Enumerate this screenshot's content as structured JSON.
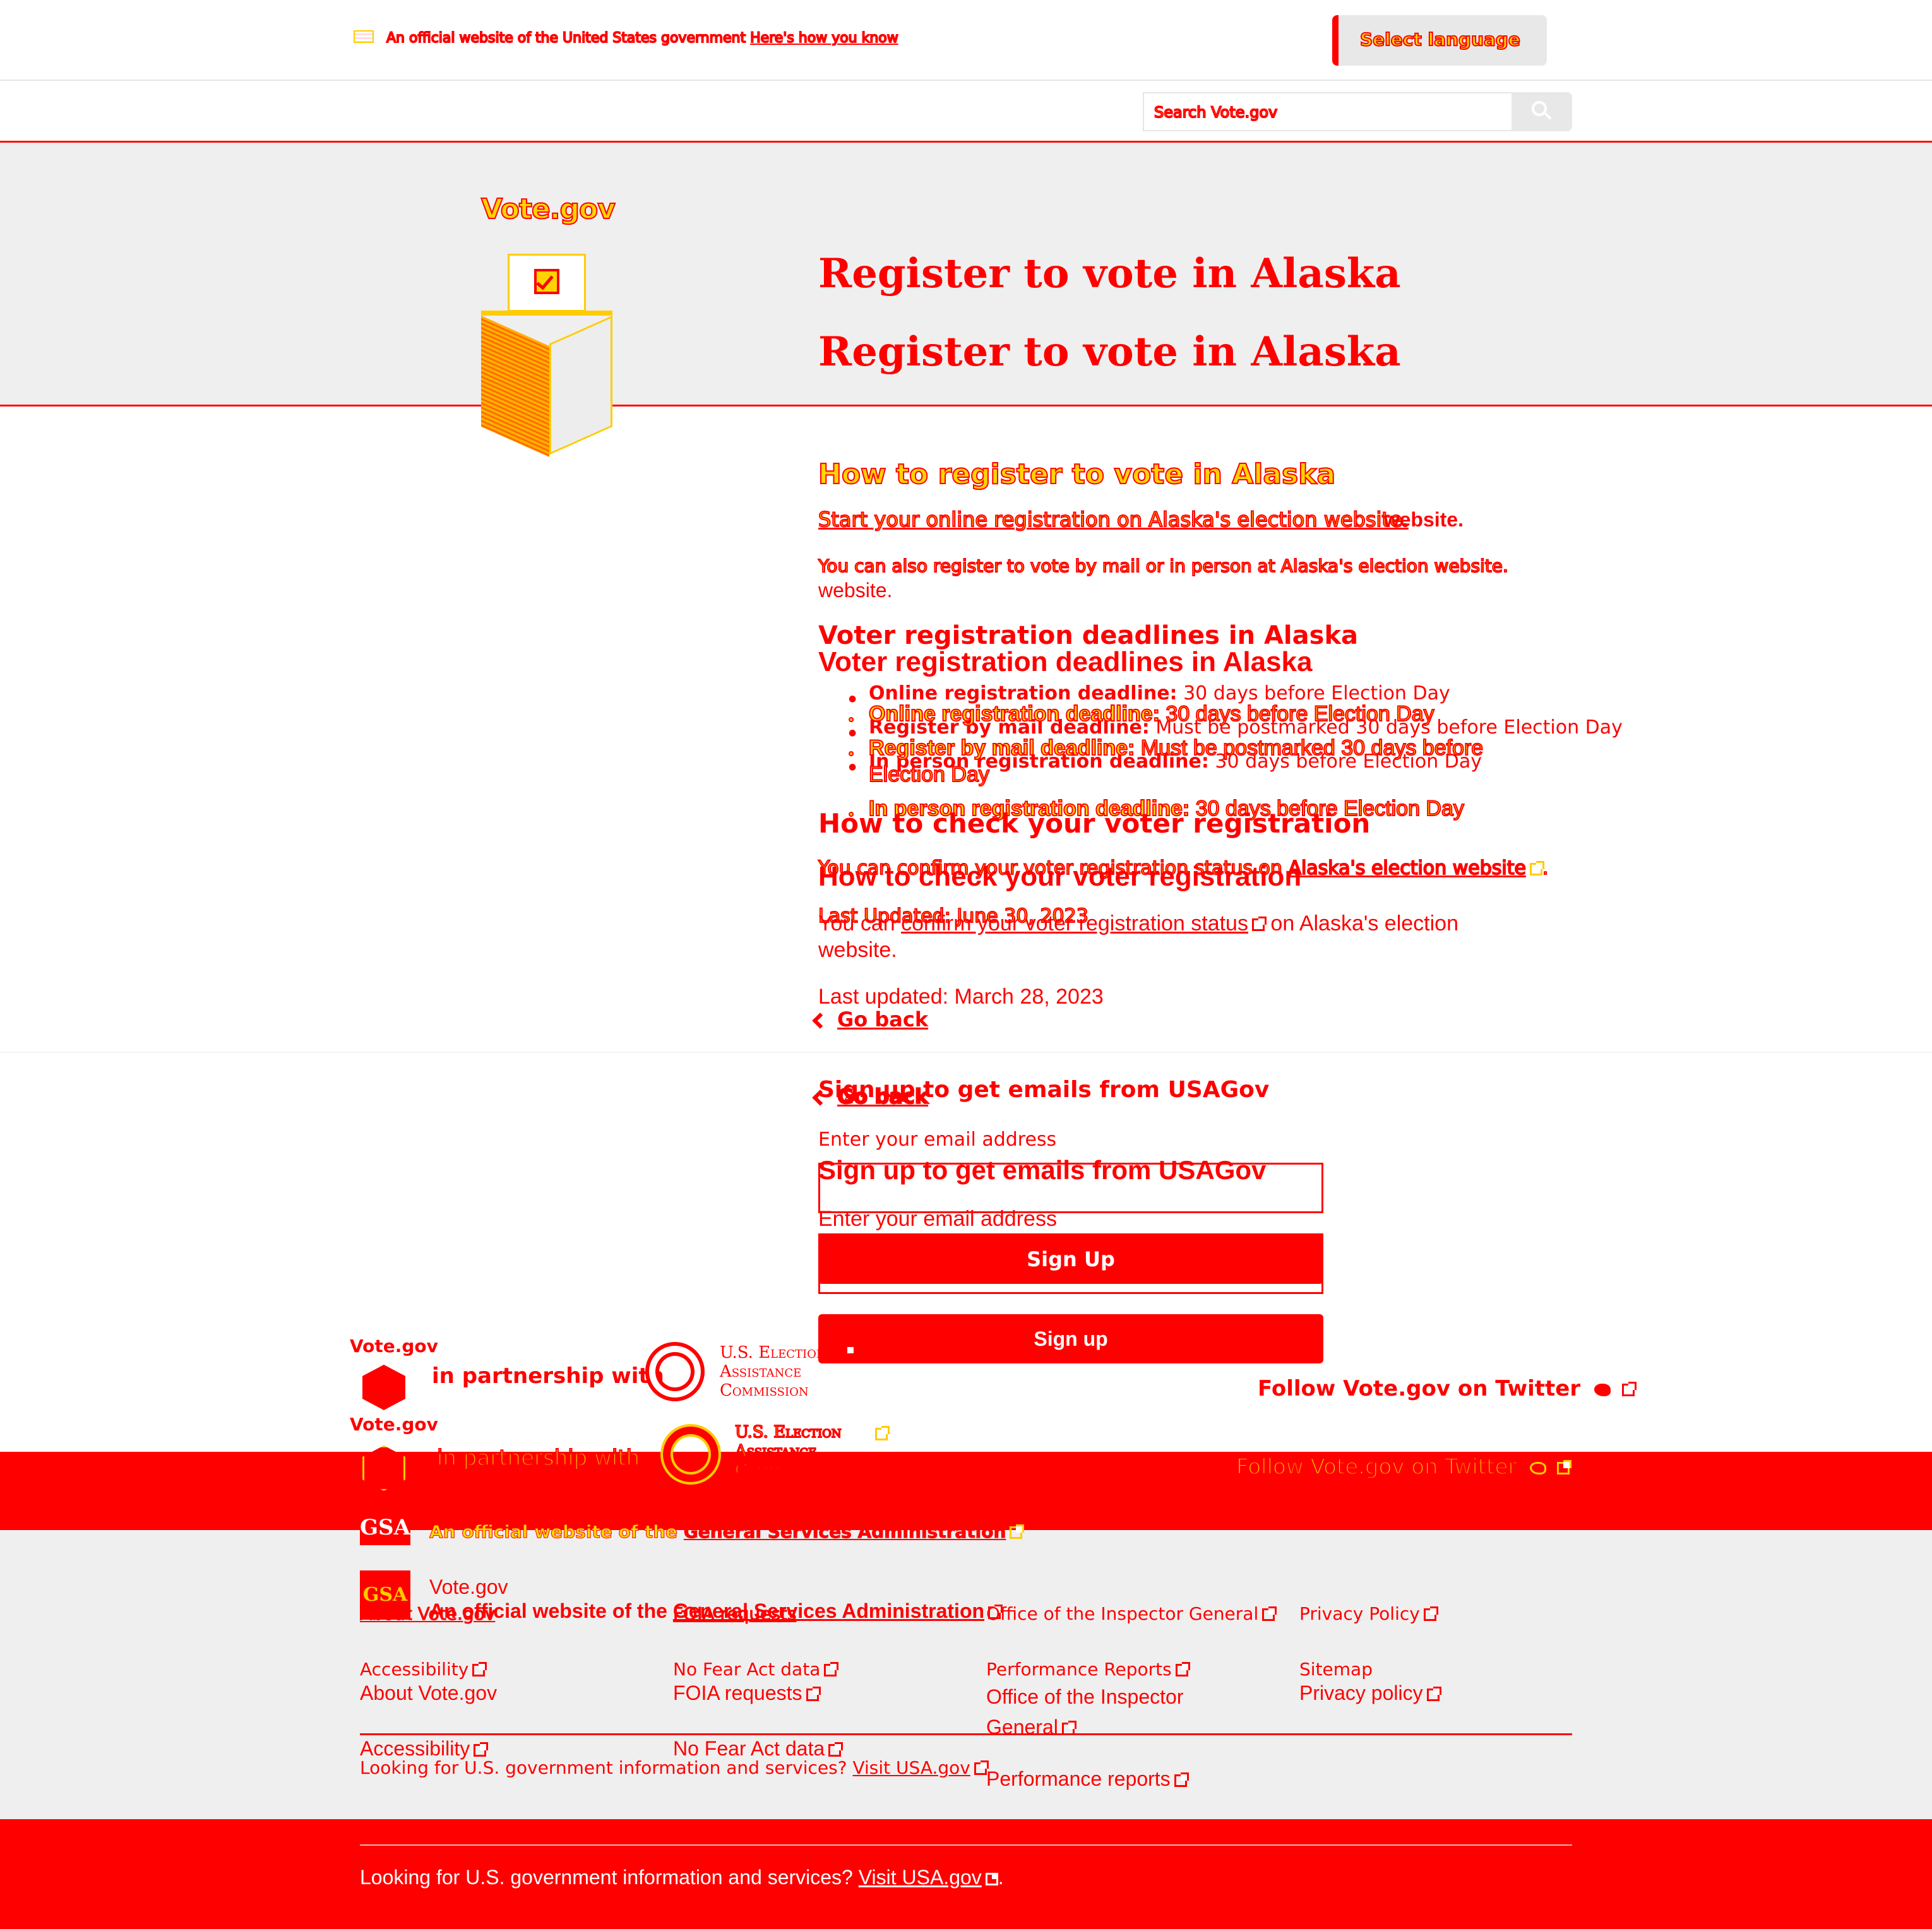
{
  "banner": {
    "official_text": "An official website of the United States government",
    "heres_how": "Here's how you know",
    "language_button": "Select language"
  },
  "search": {
    "placeholder": "Search Vote.gov"
  },
  "brand": {
    "logo_text": "Vote.gov"
  },
  "hero": {
    "title_a": "Register to vote in Alaska",
    "title_b": "Register to vote in Alaska"
  },
  "content": {
    "how_heading": "How to register to vote in Alaska",
    "start_a": "Start your online registration on Alaska's election website.",
    "start_b_prefix": "Start your online registration on Alaska's election ",
    "start_b_suffix": "website.",
    "mail_a": "You can also register to vote by mail or in person at Alaska's election website.",
    "mail_b_suffix": "website.",
    "deadlines_heading_a": "Voter registration deadlines in Alaska",
    "deadlines_heading_b": "Voter registration deadlines in Alaska",
    "deadlines_a": [
      {
        "label": "Online registration deadline:",
        "value": " 30 days before Election Day"
      },
      {
        "label": "Register by mail deadline:",
        "value": " Must be postmarked 30 days before Election Day"
      },
      {
        "label": "In person registration deadline:",
        "value": " 30 days before Election Day"
      }
    ],
    "deadlines_b": [
      {
        "label": "Online registration deadline:",
        "value": " 30 days before Election Day"
      },
      {
        "label": "Register by mail deadline:",
        "value": " Must be postmarked 30 days before Election Day"
      },
      {
        "label": "In person registration deadline:",
        "value": " 30 days before Election Day"
      }
    ],
    "check_heading_a": "How to check your voter registration",
    "check_heading_b": "How to check your voter registration",
    "check_a_prefix": "You can confirm your voter registration status on ",
    "check_a_link": "Alaska's election website",
    "check_a_suffix": ".",
    "check_b_prefix": "You can ",
    "check_b_link": "confirm your voter registration status",
    "check_b_suffix": " on Alaska's election website.",
    "updated_a": "Last Updated: June 30, 2023",
    "updated_b": "Last updated: March 28, 2023",
    "go_back": "Go back"
  },
  "signup": {
    "heading_a": "Sign up to get emails from USAGov",
    "heading_b": "Sign up to get emails from USAGov",
    "label_a": "Enter your email address",
    "label_b": "Enter your email address",
    "button_a": "Sign Up",
    "button_b": "Sign up"
  },
  "partner": {
    "logo_text": "Vote.gov",
    "in_partnership": "in partnership with",
    "eac_line1": "U.S. Election",
    "eac_line2": "Assistance",
    "eac_line3": "Commission",
    "twitter": "Follow Vote.gov on Twitter"
  },
  "footer": {
    "gsa": "GSA",
    "site_name": "Vote.gov",
    "official_prefix": "An official website of the ",
    "official_link": "General Services Administration",
    "links_a": [
      "About Vote.gov",
      "Accessibility",
      "No Fear Act data",
      "FOIA requests",
      "Office of the Inspector General",
      "Performance Reports",
      "Privacy Policy",
      "Sitemap"
    ],
    "links_b": [
      "About Vote.gov",
      "Accessibility",
      "No Fear Act data",
      "FOIA requests",
      "Office of the Inspector General",
      "Performance reports",
      "Privacy policy"
    ],
    "usa_a_prefix": "Looking for U.S. government information and services? ",
    "usa_a_link": "Visit USA.gov",
    "usa_b_prefix": "Looking for U.S. government information and services? ",
    "usa_b_link": "Visit USA.gov",
    "usa_b_suffix": "."
  },
  "colors": {
    "primary": "#ff0000",
    "highlight": "#ffd400",
    "hero_bg": "#efefef"
  }
}
